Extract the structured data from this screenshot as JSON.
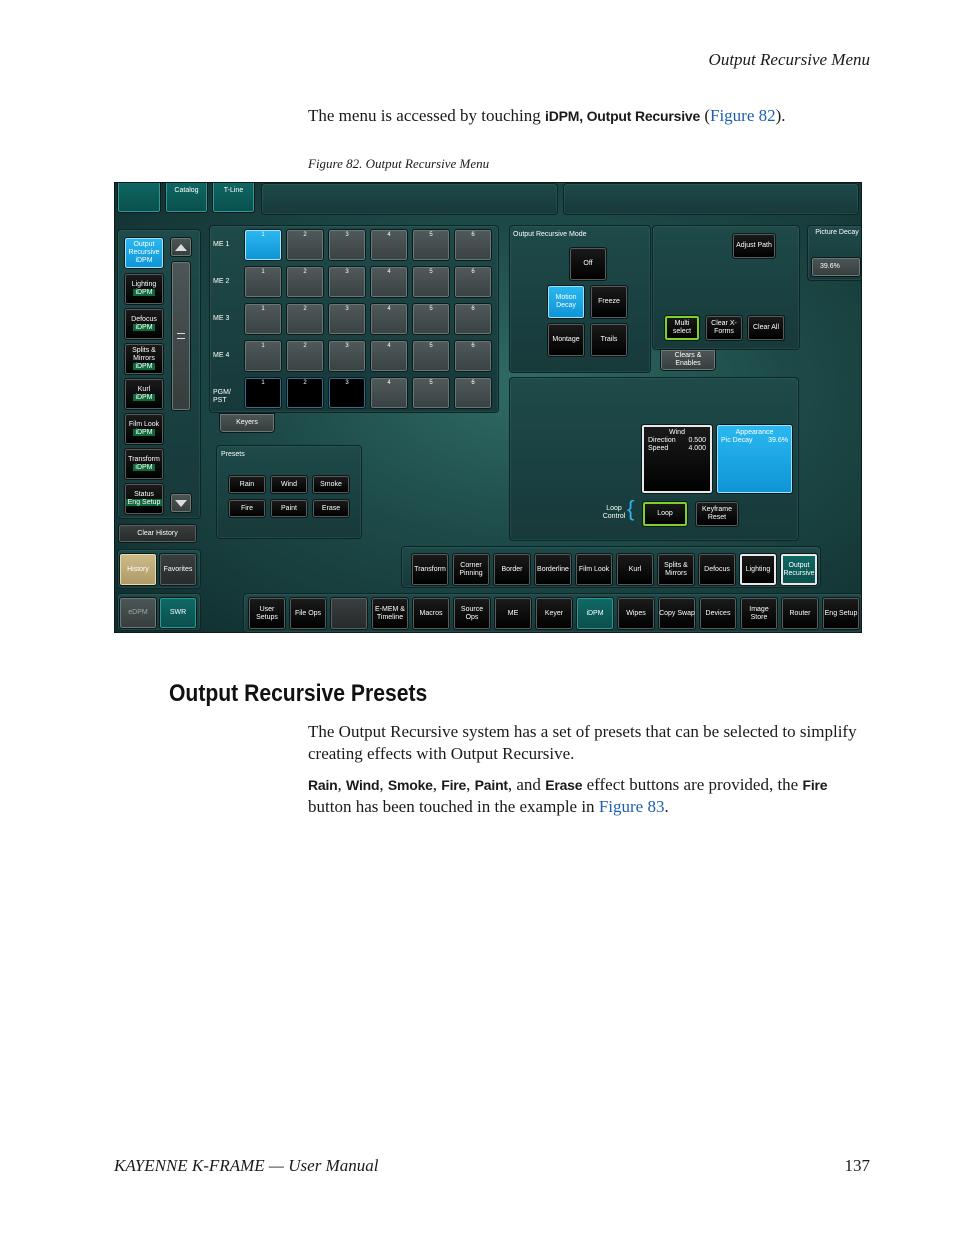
{
  "running_head": "Output Recursive Menu",
  "intro": {
    "before": "The menu is accessed by touching ",
    "bold": "iDPM, Output Recursive",
    "paren_open": " (",
    "link": "Figure 82",
    "paren_close": ")."
  },
  "figure_caption": "Figure 82.  Output Recursive Menu",
  "ui": {
    "top_tabs": [
      "Catalog",
      "T-Line"
    ],
    "sidebar": {
      "items": [
        {
          "label": "Output Recursive",
          "sub": "iDPM",
          "selected": true
        },
        {
          "label": "Lighting",
          "sub": "iDPM"
        },
        {
          "label": "Defocus",
          "sub": "iDPM"
        },
        {
          "label": "Splits & Mirrors",
          "sub": "iDPM"
        },
        {
          "label": "Kurl",
          "sub": "iDPM"
        },
        {
          "label": "Film Look",
          "sub": "iDPM"
        },
        {
          "label": "Transform",
          "sub": "iDPM"
        },
        {
          "label": "Status",
          "sub": "Eng  Setup"
        }
      ],
      "clear_history": "Clear History",
      "history": "History",
      "favorites": "Favorites",
      "edpm": "eDPM",
      "swr": "SWR"
    },
    "grid": {
      "rows": [
        "ME 1",
        "ME 2",
        "ME 3",
        "ME 4",
        "PGM/ PST"
      ],
      "cols": [
        "1",
        "2",
        "3",
        "4",
        "5",
        "6"
      ],
      "keyers": "Keyers"
    },
    "presets": {
      "title": "Presets",
      "buttons": [
        "Rain",
        "Wind",
        "Smoke",
        "Fire",
        "Paint",
        "Erase"
      ]
    },
    "mode": {
      "title": "Output Recursive Mode",
      "off": "Off",
      "motion_decay": "Motion Decay",
      "freeze": "Freeze",
      "montage": "Montage",
      "trails": "Trails"
    },
    "clears": {
      "adjust_path": "Adjust Path",
      "multi_select": "Multi select",
      "clear_xforms": "Clear X-Forms",
      "clear_all": "Clear All",
      "tab": "Clears & Enables"
    },
    "picture_decay": {
      "label": "Picture Decay",
      "value": "39.6%"
    },
    "wind_box": {
      "title": "Wind",
      "direction_label": "Direction",
      "direction_value": "0.500",
      "speed_label": "Speed",
      "speed_value": "4.000"
    },
    "appearance_box": {
      "title": "Appearance",
      "label": "Pic Decay",
      "value": "39.6%"
    },
    "loop": {
      "control_label": "Loop Control",
      "loop": "Loop",
      "keyframe_reset": "Keyframe Reset"
    },
    "idpm_row": [
      "Transform",
      "Corner Pinning",
      "Border",
      "Borderline",
      "Film Look",
      "Kurl",
      "Splits & Mirrors",
      "Defocus",
      "Lighting",
      "Output Recursive"
    ],
    "menu_row": [
      "User Setups",
      "File Ops",
      "",
      "E-MEM & Timeline",
      "Macros",
      "Source Ops",
      "ME",
      "Keyer",
      "iDPM",
      "Wipes",
      "Copy Swap",
      "Devices",
      "Image Store",
      "Router",
      "Eng Setup"
    ]
  },
  "section_title": "Output Recursive Presets",
  "para1": "The Output Recursive system has a set of presets that can be selected to simplify creating effects with Output Recursive.",
  "para2": {
    "b_rain": "Rain",
    "c1": ", ",
    "b_wind": "Wind",
    "c2": ", ",
    "b_smoke": "Smoke",
    "c3": ", ",
    "b_fire": "Fire",
    "c4": ", ",
    "b_paint": "Paint",
    "c5": ", and ",
    "b_erase": "Erase",
    "mid": " effect buttons are provided, the ",
    "b_fire2": "Fire",
    "end": " button has been touched in the example in ",
    "link": "Figure 83",
    "period": "."
  },
  "footer": {
    "left": "KAYENNE K-FRAME  —  User Manual",
    "page": "137"
  }
}
